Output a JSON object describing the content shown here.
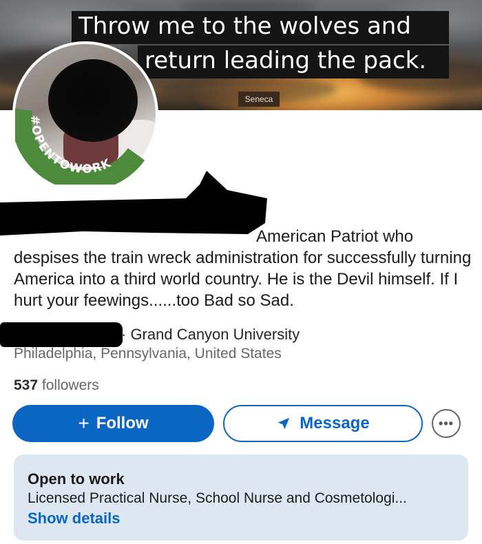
{
  "banner": {
    "quote_line1": "Throw me to the wolves and",
    "quote_line2": "return leading the pack.",
    "quote_author": "Seneca"
  },
  "avatar": {
    "open_to_work_badge": "#OPENTOWORK",
    "badge_color": "#4e8a3c"
  },
  "profile": {
    "headline_visible": "American Patriot who despises the train wreck administration for successfully turning America into a third world country.  He is the Devil himself.  If I hurt your feewings......too Bad so Sad.",
    "education": "· Grand Canyon University",
    "location": "Philadelphia, Pennsylvania, United States",
    "followers_count": "537",
    "followers_label": "followers"
  },
  "actions": {
    "follow_label": "Follow",
    "follow_icon": "plus-icon",
    "message_label": "Message",
    "message_icon": "send-icon",
    "more_icon": "more-horizontal-icon",
    "accent_color": "#0a66c2"
  },
  "open_to_work": {
    "title": "Open to work",
    "roles": "Licensed Practical Nurse, School Nurse and Cosmetologi...",
    "details_link": "Show details"
  }
}
